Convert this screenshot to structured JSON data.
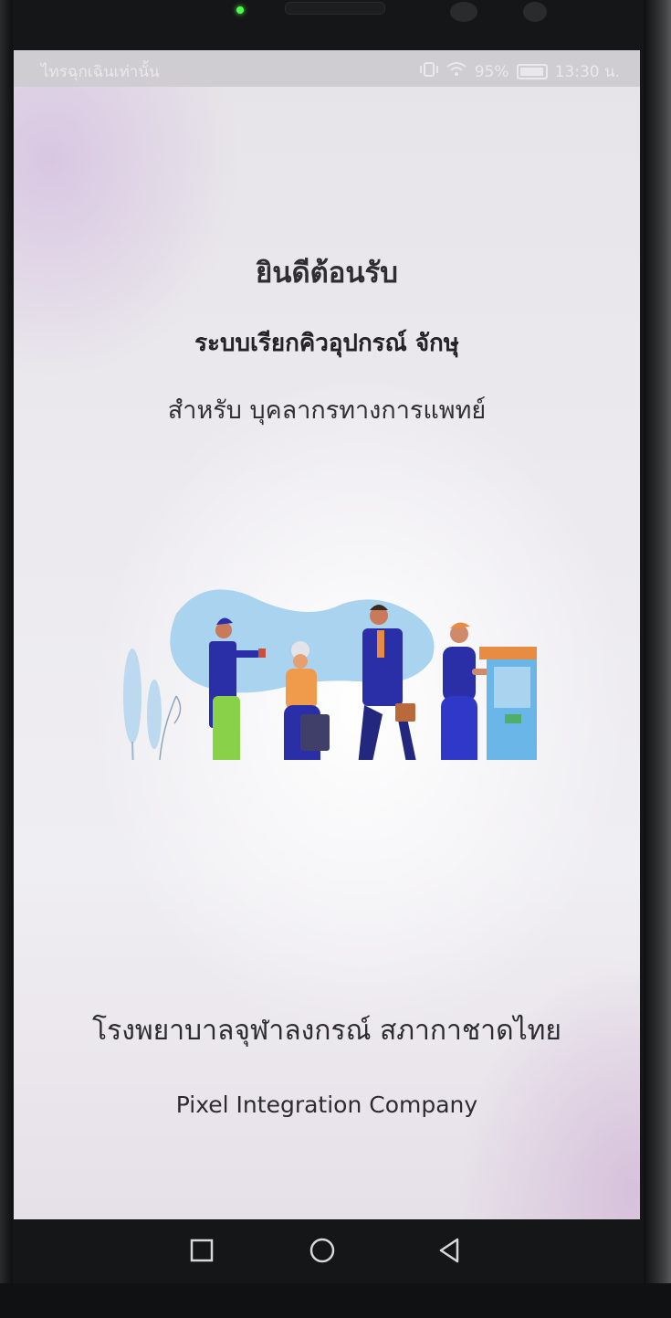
{
  "status_bar": {
    "left_text": "ไทรฉุกเฉินเท่านั้น",
    "battery": "95%",
    "time": "13:30 น."
  },
  "main": {
    "welcome": "ยินดีต้อนรับ",
    "system_name": "ระบบเรียกคิวอุปกรณ์ จักษุ",
    "audience": "สำหรับ บุคลากรทางการแพทย์",
    "illustration": "people-queueing-at-kiosk-illustration"
  },
  "footer": {
    "hospital": "โรงพยาบาลจุฬาลงกรณ์ สภากาชาดไทย",
    "company": "Pixel Integration Company"
  },
  "nav_bar": {
    "recent_icon": "square-icon",
    "home_icon": "circle-icon",
    "back_icon": "triangle-back-icon"
  },
  "colors": {
    "accent_blue": "#2a2fa8",
    "light_blue": "#a9d3ee",
    "kiosk_orange": "#e88c44"
  }
}
